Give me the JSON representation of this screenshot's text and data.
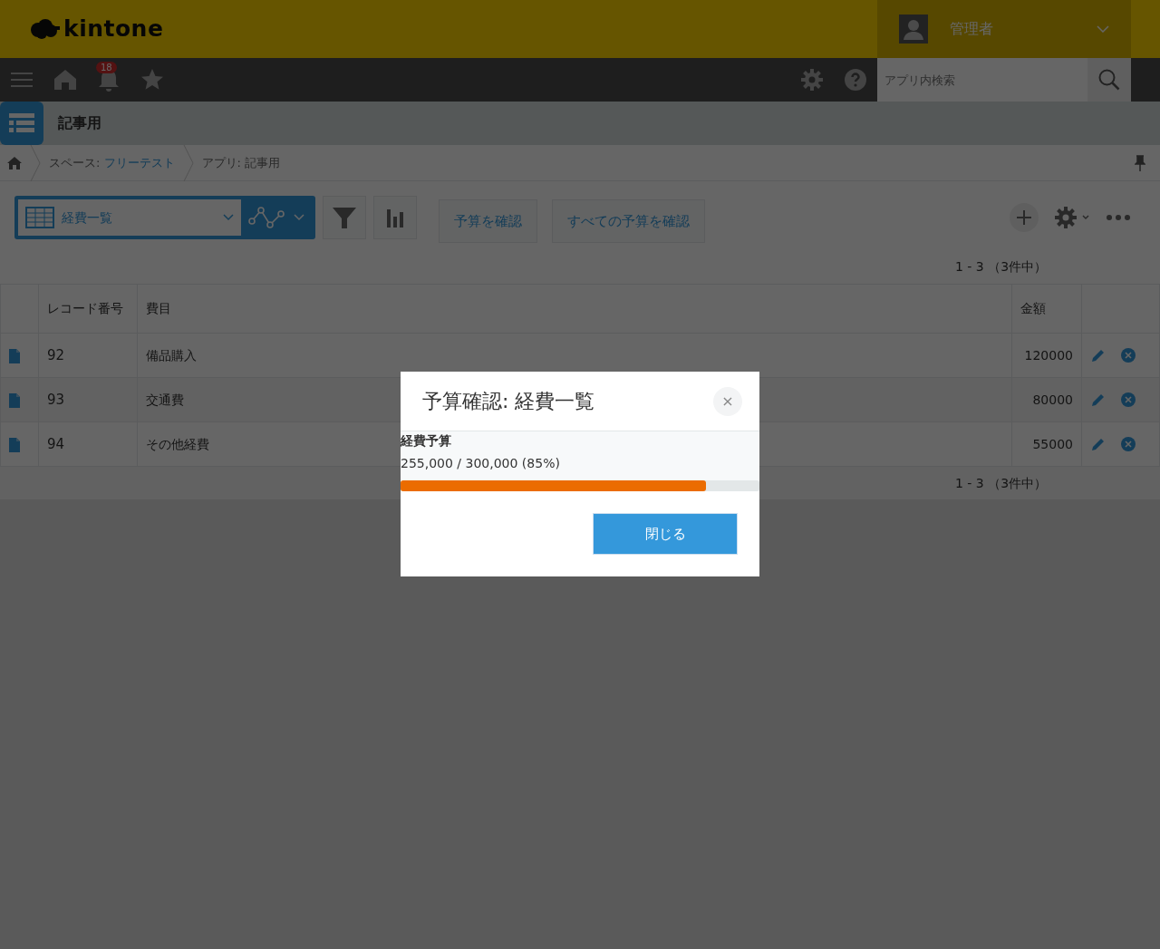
{
  "header": {
    "logo": "kintone",
    "user": "管理者"
  },
  "nav": {
    "notification_count": "18",
    "search": {
      "placeholder": "アプリ内検索"
    }
  },
  "app": {
    "title": "記事用"
  },
  "breadcrumb": [
    {
      "kind": "link",
      "label": "スペース:",
      "value": "フリーテスト"
    },
    {
      "kind": "text",
      "label": "アプリ:",
      "value": "記事用"
    }
  ],
  "toolbar": {
    "view": "経費一覧",
    "buttons": [
      "予算を確認",
      "すべての予算を確認"
    ]
  },
  "pager_top": "1 - 3 （3件中）",
  "table": {
    "columns": [
      "レコード番号",
      "費目",
      "金額"
    ],
    "rows": [
      [
        "92",
        "備品購入",
        "120000"
      ],
      [
        "93",
        "交通費",
        "80000"
      ],
      [
        "94",
        "その他経費",
        "55000"
      ]
    ]
  },
  "pager_bottom": "1 - 3 （3件中）",
  "dialog": {
    "title": "予算確認: 経費一覧",
    "close": "×",
    "label": "経費予算",
    "reading": "255,000 / 300,000 (85%)",
    "level": 0.85,
    "button": "閉じる"
  }
}
